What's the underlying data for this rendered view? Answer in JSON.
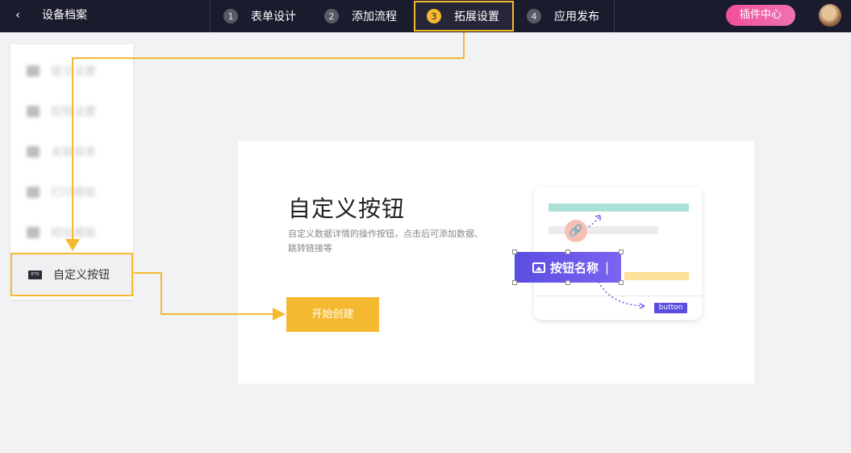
{
  "header": {
    "back_glyph": "‹",
    "title": "设备档案",
    "steps": [
      {
        "num": "1",
        "label": "表单设计"
      },
      {
        "num": "2",
        "label": "添加流程"
      },
      {
        "num": "3",
        "label": "拓展设置"
      },
      {
        "num": "4",
        "label": "应用发布"
      }
    ],
    "plugin_label": "插件中心"
  },
  "sidebar": {
    "items": [
      {
        "label": "提交设置"
      },
      {
        "label": "权限设置"
      },
      {
        "label": "关联报表"
      },
      {
        "label": "打印模板"
      },
      {
        "label": "短信模板"
      },
      {
        "label": "自定义按钮",
        "icon_text": "BTN"
      }
    ]
  },
  "card": {
    "title": "自定义按钮",
    "desc": "自定义数据详情的操作按钮，点击后可添加数据、跳转链接等",
    "start_label": "开始创建",
    "preview_button_label": "按钮名称",
    "preview_tag": "button"
  },
  "colors": {
    "accent": "#f4b930",
    "topbar": "#1b1b2e",
    "plugin": "#f14f9b",
    "primary_purple": "#5b4de0"
  }
}
